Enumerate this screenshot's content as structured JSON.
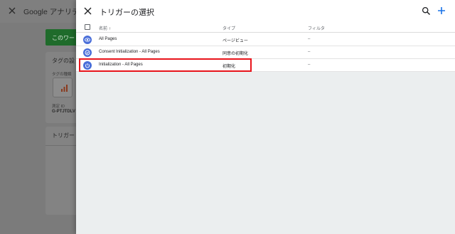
{
  "background": {
    "app_title": "Google アナリティ",
    "green_button_label": "このワー",
    "card_title": "タグの設",
    "card_sub": "タグの種類",
    "measurement_label": "測定 ID",
    "measurement_id": "G-PTJTDLV",
    "triggers_title": "トリガー"
  },
  "panel": {
    "title": "トリガーの選択",
    "columns": {
      "name": "名前",
      "sort": "↑",
      "type": "タイプ",
      "filter": "フィルタ"
    },
    "rows": [
      {
        "name": "All Pages",
        "type": "ページビュー",
        "filter": "–",
        "icon": "eye-icon"
      },
      {
        "name": "Consent Initialization - All Pages",
        "type": "同意の初期化",
        "filter": "–",
        "icon": "consent-icon"
      },
      {
        "name": "Initialization - All Pages",
        "type": "初期化",
        "filter": "–",
        "icon": "power-icon"
      }
    ]
  },
  "colors": {
    "highlight": "#e8141b",
    "trigger_icon": "#4a6fd9"
  }
}
